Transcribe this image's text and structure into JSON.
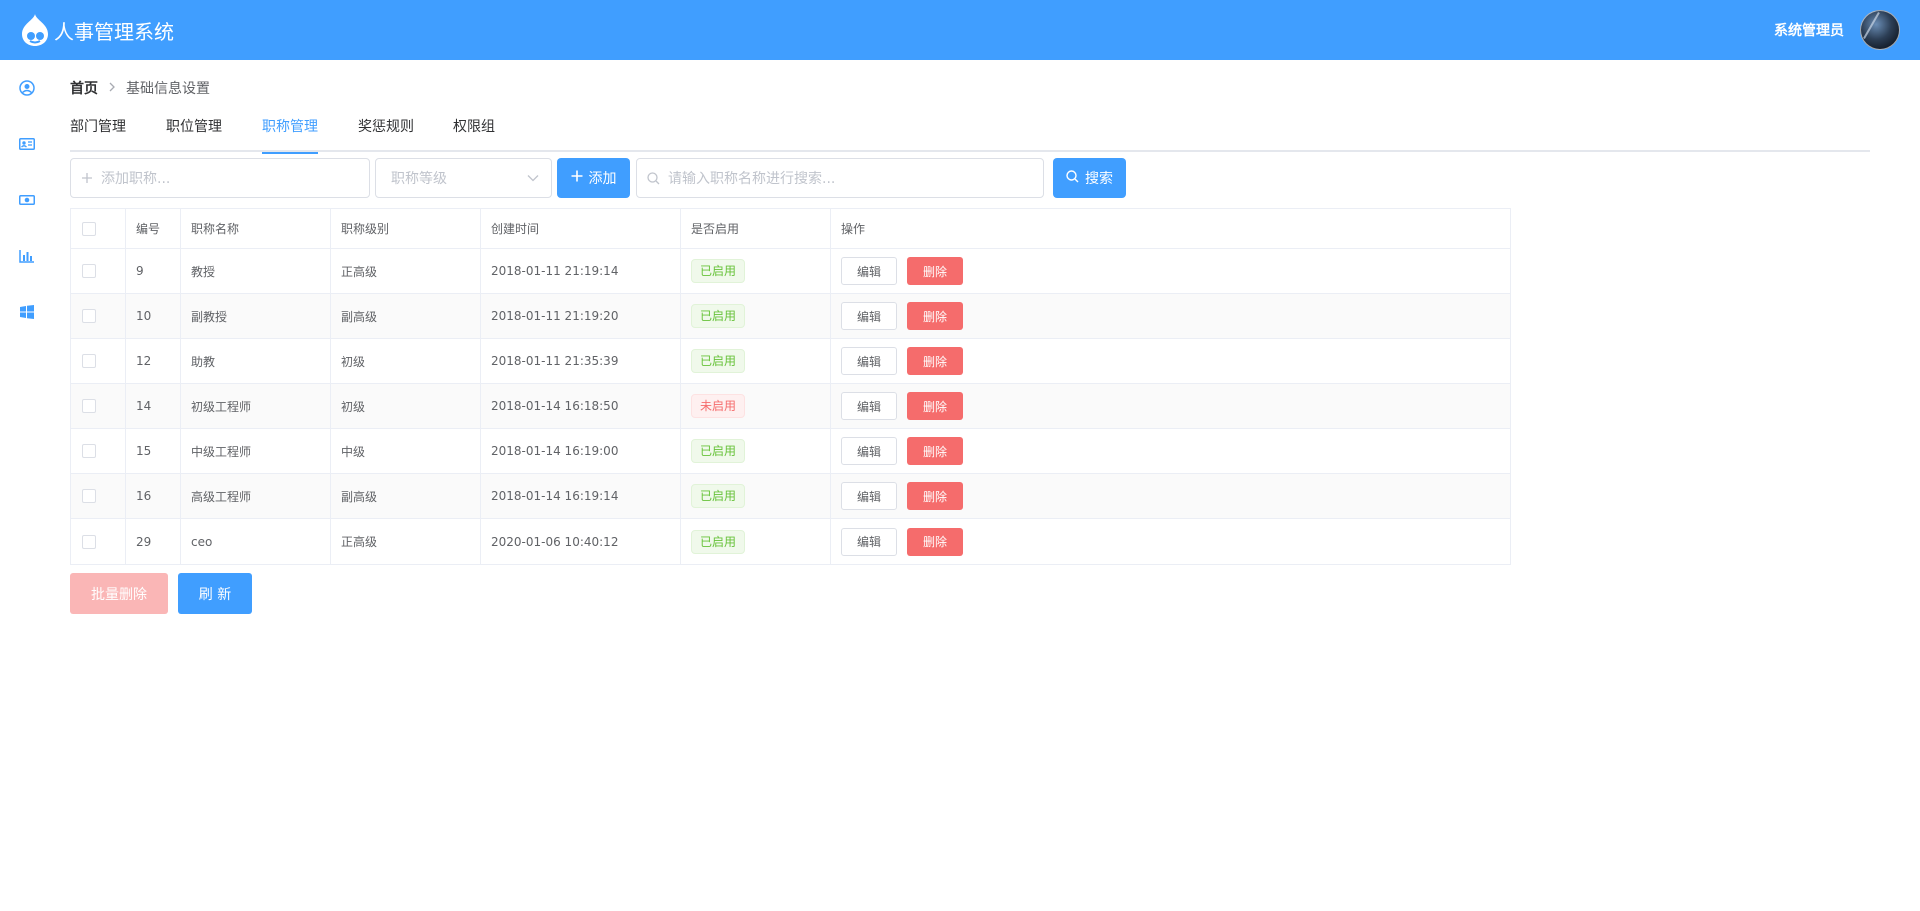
{
  "header": {
    "title": "人事管理系统",
    "username": "系统管理员",
    "color": "#409eff"
  },
  "sidebar": {
    "icons": [
      "user-circle-icon",
      "id-card-icon",
      "money-icon",
      "bar-chart-icon",
      "windows-icon"
    ]
  },
  "breadcrumb": {
    "home": "首页",
    "current": "基础信息设置"
  },
  "tabs": [
    {
      "label": "部门管理",
      "active": false
    },
    {
      "label": "职位管理",
      "active": false
    },
    {
      "label": "职称管理",
      "active": true
    },
    {
      "label": "奖惩规则",
      "active": false
    },
    {
      "label": "权限组",
      "active": false
    }
  ],
  "toolbar": {
    "add_input_placeholder": "添加职称...",
    "level_select_placeholder": "职称等级",
    "add_button": "添加",
    "search_placeholder": "请输入职称名称进行搜索...",
    "search_button": "搜索"
  },
  "table": {
    "columns": [
      "编号",
      "职称名称",
      "职称级别",
      "创建时间",
      "是否启用",
      "操作"
    ],
    "edit_label": "编辑",
    "delete_label": "删除",
    "rows": [
      {
        "id": "9",
        "name": "教授",
        "level": "正高级",
        "created": "2018-01-11 21:19:14",
        "status": "已启用",
        "enabled": true
      },
      {
        "id": "10",
        "name": "副教授",
        "level": "副高级",
        "created": "2018-01-11 21:19:20",
        "status": "已启用",
        "enabled": true
      },
      {
        "id": "12",
        "name": "助教",
        "level": "初级",
        "created": "2018-01-11 21:35:39",
        "status": "已启用",
        "enabled": true
      },
      {
        "id": "14",
        "name": "初级工程师",
        "level": "初级",
        "created": "2018-01-14 16:18:50",
        "status": "未启用",
        "enabled": false
      },
      {
        "id": "15",
        "name": "中级工程师",
        "level": "中级",
        "created": "2018-01-14 16:19:00",
        "status": "已启用",
        "enabled": true
      },
      {
        "id": "16",
        "name": "高级工程师",
        "level": "副高级",
        "created": "2018-01-14 16:19:14",
        "status": "已启用",
        "enabled": true
      },
      {
        "id": "29",
        "name": "ceo",
        "level": "正高级",
        "created": "2020-01-06 10:40:12",
        "status": "已启用",
        "enabled": true
      }
    ]
  },
  "footer": {
    "batch_delete": "批量删除",
    "refresh": "刷 新"
  }
}
